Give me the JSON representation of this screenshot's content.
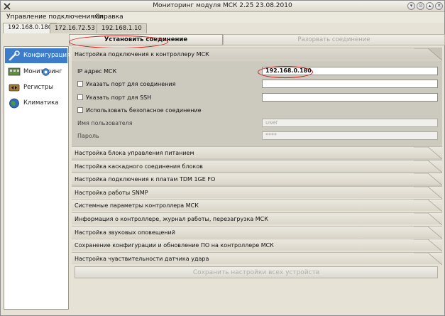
{
  "window": {
    "title": "Мониторинг модуля МСК 2.25 23.08.2010",
    "controls": [
      "▾",
      "⊙",
      "▴",
      "✕"
    ]
  },
  "menu": {
    "items": [
      "Управление подключениями",
      "Справка"
    ]
  },
  "tabs": [
    {
      "label": "192.168.0.180",
      "active": true
    },
    {
      "label": "172.16.72.53",
      "active": false
    },
    {
      "label": "192.168.1.10",
      "active": false
    }
  ],
  "connection": {
    "connect_label": "Установить соединение",
    "disconnect_label": "Разорвать соединение"
  },
  "sidebar": {
    "items": [
      {
        "label": "Конфигурация",
        "icon": "wrench-icon",
        "active": true
      },
      {
        "label": "Мониторинг",
        "icon": "monitor-icon",
        "active": false
      },
      {
        "label": "Регистры",
        "icon": "register-icon",
        "active": false
      },
      {
        "label": "Климатика",
        "icon": "globe-icon",
        "active": false
      }
    ]
  },
  "main": {
    "open_section": "Настройка подключения к контроллеру МСК",
    "form": {
      "ip_label": "IP адрес МСК",
      "ip_value": "192.168.0.180",
      "port_conn_label": "Указать порт для соединения",
      "port_ssh_label": "Указать порт для SSH",
      "secure_label": "Использовать безопасное соединение",
      "user_label": "Имя пользователя",
      "user_value": "user",
      "password_label": "Пароль",
      "password_value": "****"
    },
    "sections": [
      "Настройка блока управления питанием",
      "Настройка каскадного соединения блоков",
      "Настройка подключения к платам TDM 1GE FO",
      "Настройка работы SNMP",
      "Системные параметры контроллера МСК",
      "Информация о контроллере, журнал работы, перезагрузка МСК",
      "Настройка звуковых оповещений",
      "Сохранение конфигурации и обновление ПО на контроллере МСК",
      "Настройка чувствительности датчика удара"
    ],
    "save_label": "Сохранить настройки всех устройств"
  },
  "colors": {
    "accent": "#3d7cc9",
    "highlight_ellipse": "#d41a1a"
  }
}
